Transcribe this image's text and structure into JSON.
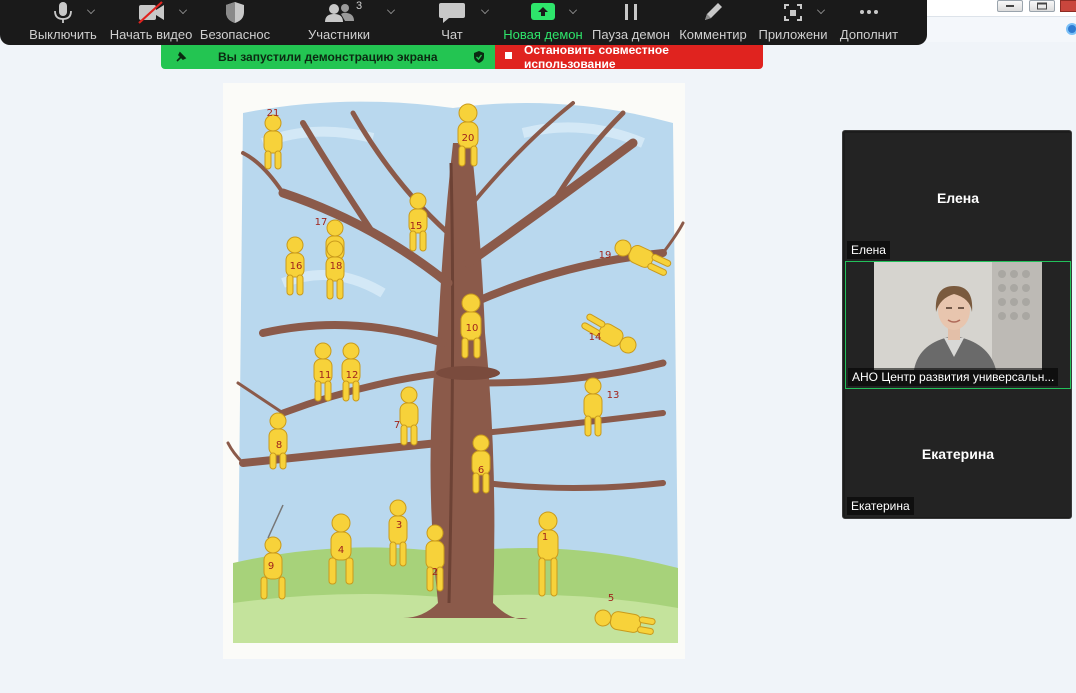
{
  "toolbar": {
    "items": [
      {
        "label": "Выключить",
        "icon": "microphone-icon"
      },
      {
        "label": "Начать видео",
        "icon": "video-off-icon"
      },
      {
        "label": "Безопаснос",
        "icon": "shield-icon"
      },
      {
        "label": "Участники",
        "icon": "participants-icon",
        "count": "3"
      },
      {
        "label": "Чат",
        "icon": "chat-icon"
      },
      {
        "label": "Новая демон",
        "icon": "share-screen-icon"
      },
      {
        "label": "Пауза демон",
        "icon": "pause-icon"
      },
      {
        "label": "Комментир",
        "icon": "pencil-icon"
      },
      {
        "label": "Приложени",
        "icon": "apps-icon"
      },
      {
        "label": "Дополнит",
        "icon": "more-icon"
      }
    ]
  },
  "share_banner": {
    "status": "Вы запустили демонстрацию экрана",
    "stop": "Остановить совместное использование"
  },
  "shared_image": {
    "figure_numbers": [
      "1",
      "2",
      "3",
      "4",
      "5",
      "6",
      "7",
      "8",
      "9",
      "10",
      "11",
      "12",
      "13",
      "14",
      "15",
      "16",
      "17",
      "18",
      "19",
      "20",
      "21"
    ]
  },
  "gallery": {
    "tiles": [
      {
        "display_name": "Елена",
        "name_tag": "Елена"
      },
      {
        "name_tag": "АНО Центр развития универсальн..."
      },
      {
        "display_name": "Екатерина",
        "name_tag": "Екатерина"
      }
    ]
  },
  "colors": {
    "toolbar_bg": "#1a1a1a",
    "share_green": "#23c552",
    "share_red": "#e0231f",
    "active_speaker": "#22c05a"
  }
}
